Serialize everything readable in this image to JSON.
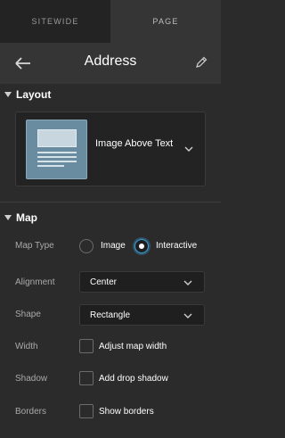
{
  "tabs": {
    "sitewide": "SITEWIDE",
    "page": "PAGE"
  },
  "header": {
    "title": "Address",
    "back_icon": "arrow-left-icon",
    "edit_icon": "pencil-icon"
  },
  "layout": {
    "section_title": "Layout",
    "selected": "Image Above Text"
  },
  "map": {
    "section_title": "Map",
    "map_type": {
      "label": "Map Type",
      "options": [
        "Image",
        "Interactive"
      ],
      "selected": "Interactive"
    },
    "alignment": {
      "label": "Alignment",
      "value": "Center"
    },
    "shape": {
      "label": "Shape",
      "value": "Rectangle"
    },
    "width": {
      "label": "Width",
      "checkbox_label": "Adjust map width",
      "checked": false
    },
    "shadow": {
      "label": "Shadow",
      "checkbox_label": "Add drop shadow",
      "checked": false
    },
    "borders": {
      "label": "Borders",
      "checkbox_label": "Show borders",
      "checked": false
    }
  },
  "colors": {
    "accent": "#3aa0d8",
    "panel": "#2b2b2b",
    "header": "#353535"
  }
}
